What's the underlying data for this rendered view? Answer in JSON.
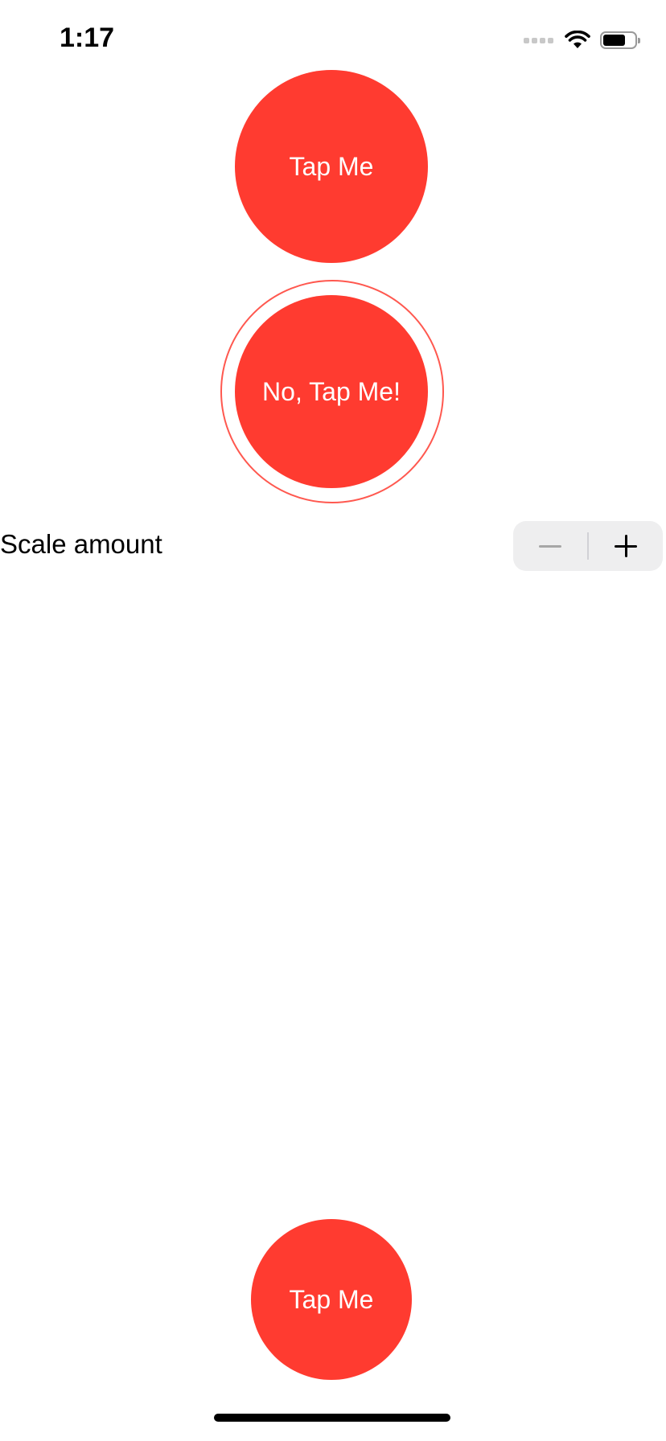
{
  "status_bar": {
    "time": "1:17",
    "battery_level": 0.7,
    "icons": [
      "cellular-signal-icon",
      "wifi-icon",
      "battery-icon"
    ]
  },
  "buttons": {
    "top_label": "Tap Me",
    "middle_label": "No, Tap Me!",
    "bottom_label": "Tap Me"
  },
  "stepper": {
    "label": "Scale amount",
    "decrement_icon": "minus-icon",
    "increment_icon": "plus-icon"
  },
  "colors": {
    "accent": "#ff3b30",
    "stepper_bg": "#eeeeef"
  }
}
